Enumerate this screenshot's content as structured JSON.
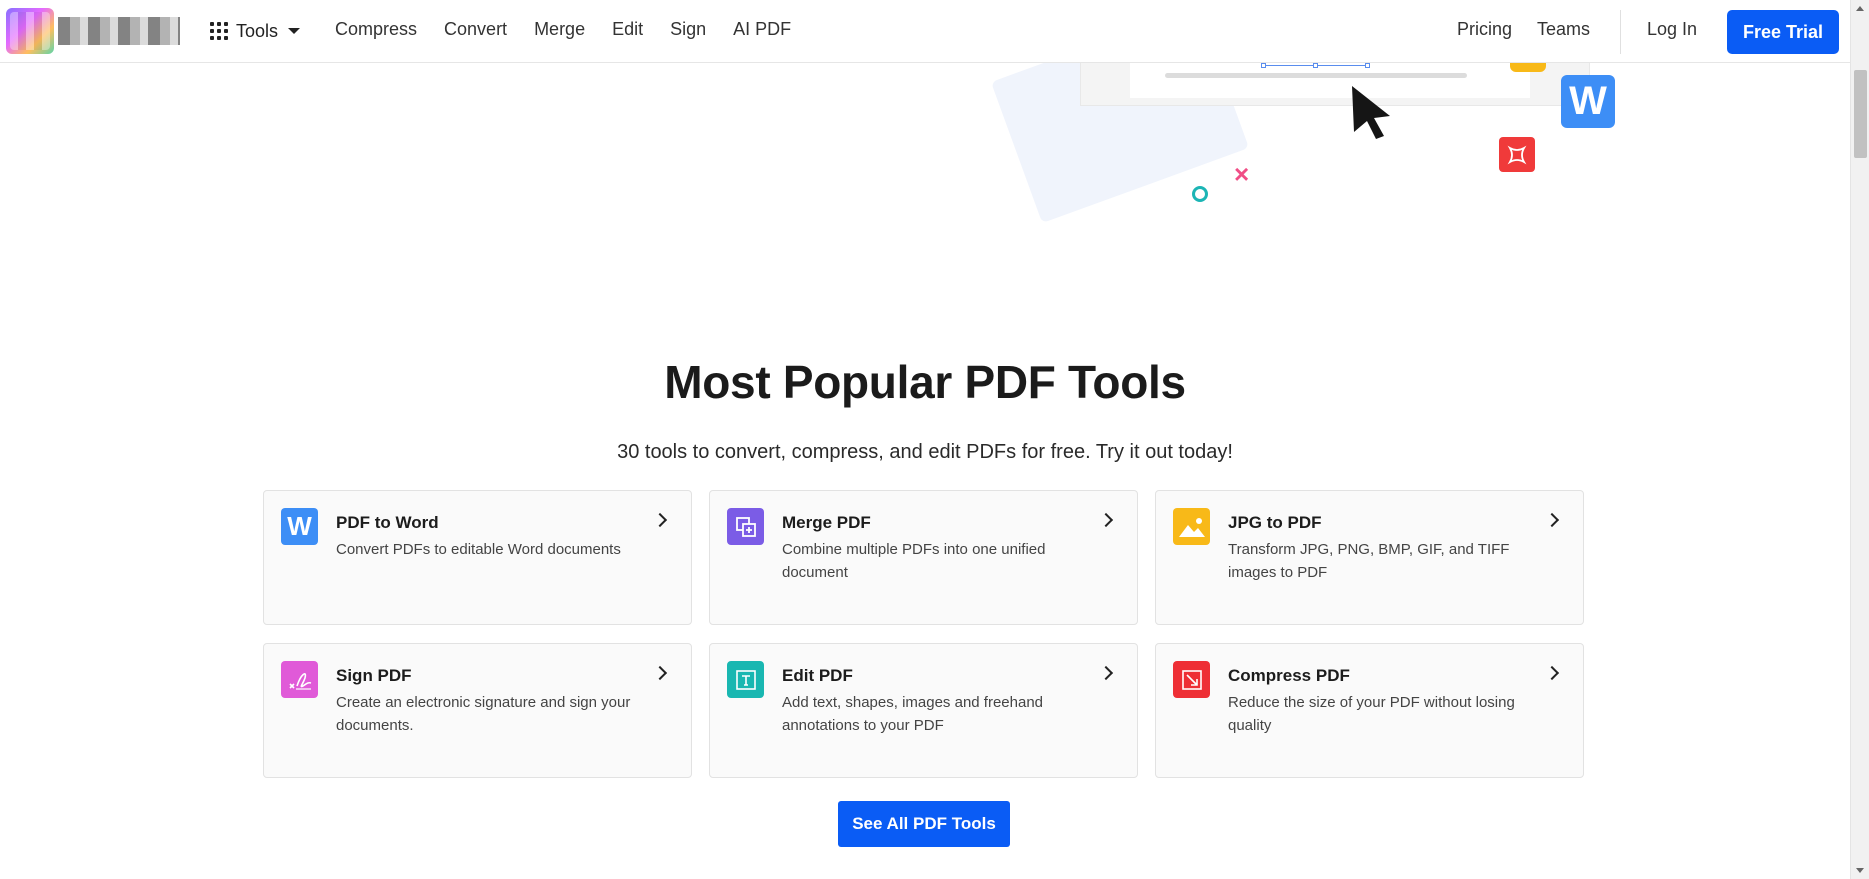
{
  "nav": {
    "tools_label": "Tools",
    "links": [
      "Compress",
      "Convert",
      "Merge",
      "Edit",
      "Sign",
      "AI PDF"
    ],
    "pricing": "Pricing",
    "teams": "Teams",
    "login": "Log In",
    "free_trial": "Free Trial"
  },
  "hero": {
    "badge_letter": "W"
  },
  "section": {
    "title": "Most Popular PDF Tools",
    "subtitle": "30 tools to convert, compress, and edit PDFs for free. Try it out today!"
  },
  "tools": [
    {
      "title": "PDF to Word",
      "desc": "Convert PDFs to editable Word documents",
      "icon": "word-icon",
      "color": "#3d8ef6"
    },
    {
      "title": "Merge PDF",
      "desc": "Combine multiple PDFs into one unified document",
      "icon": "merge-icon",
      "color": "#7b5ce6"
    },
    {
      "title": "JPG to PDF",
      "desc": "Transform JPG, PNG, BMP, GIF, and TIFF images to PDF",
      "icon": "image-icon",
      "color": "#f8b918"
    },
    {
      "title": "Sign PDF",
      "desc": "Create an electronic signature and sign your documents.",
      "icon": "signature-icon",
      "color": "#e05ad8"
    },
    {
      "title": "Edit PDF",
      "desc": "Add text, shapes, images and freehand annotations to your PDF",
      "icon": "text-edit-icon",
      "color": "#19b7b1"
    },
    {
      "title": "Compress PDF",
      "desc": "Reduce the size of your PDF without losing quality",
      "icon": "compress-icon",
      "color": "#ee2f35"
    }
  ],
  "see_all": "See All PDF Tools",
  "colors": {
    "primary": "#0a5cf5"
  }
}
